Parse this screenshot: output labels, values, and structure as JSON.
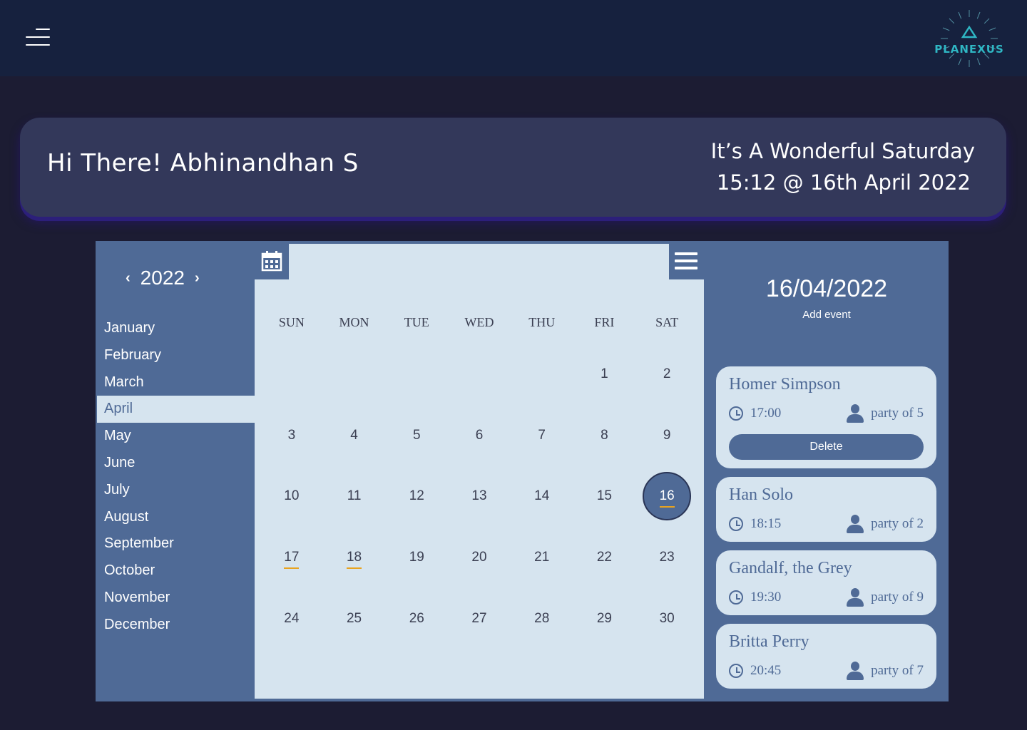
{
  "header": {
    "menu_icon": "hamburger-icon",
    "logo_text": "PLANEXUS"
  },
  "greeting": {
    "text": "Hi There! Abhinandhan S",
    "day_line": "It’s A Wonderful Saturday",
    "time_line": "15:12 @ 16th April 2022"
  },
  "calendar": {
    "year": "2022",
    "prev_icon": "chevron-left-icon",
    "next_icon": "chevron-right-icon",
    "months": [
      "January",
      "February",
      "March",
      "April",
      "May",
      "June",
      "July",
      "August",
      "September",
      "October",
      "November",
      "December"
    ],
    "active_month": "April",
    "weekdays": [
      "SUN",
      "MON",
      "TUE",
      "WED",
      "THU",
      "FRI",
      "SAT"
    ],
    "days": [
      "",
      "",
      "",
      "",
      "",
      "1",
      "2",
      "3",
      "4",
      "5",
      "6",
      "7",
      "8",
      "9",
      "10",
      "11",
      "12",
      "13",
      "14",
      "15",
      "16",
      "17",
      "18",
      "19",
      "20",
      "21",
      "22",
      "23",
      "24",
      "25",
      "26",
      "27",
      "28",
      "29",
      "30"
    ],
    "selected_day": "16",
    "event_days": [
      "16",
      "17",
      "18"
    ],
    "accent_color": "#e8a320"
  },
  "events_panel": {
    "selected_date": "16/04/2022",
    "add_event_label": "Add event",
    "delete_label": "Delete",
    "events": [
      {
        "name": "Homer Simpson",
        "time": "17:00",
        "party": "party of 5"
      },
      {
        "name": "Han Solo",
        "time": "18:15",
        "party": "party of 2"
      },
      {
        "name": "Gandalf, the Grey",
        "time": "19:30",
        "party": "party of 9"
      },
      {
        "name": "Britta Perry",
        "time": "20:45",
        "party": "party of 7"
      }
    ]
  },
  "colors": {
    "page_bg": "#1c1c33",
    "topbar_bg": "#16213e",
    "card_bg": "#33385a",
    "calendar_blue": "#4f6a96",
    "calendar_light": "#d6e4ef"
  }
}
